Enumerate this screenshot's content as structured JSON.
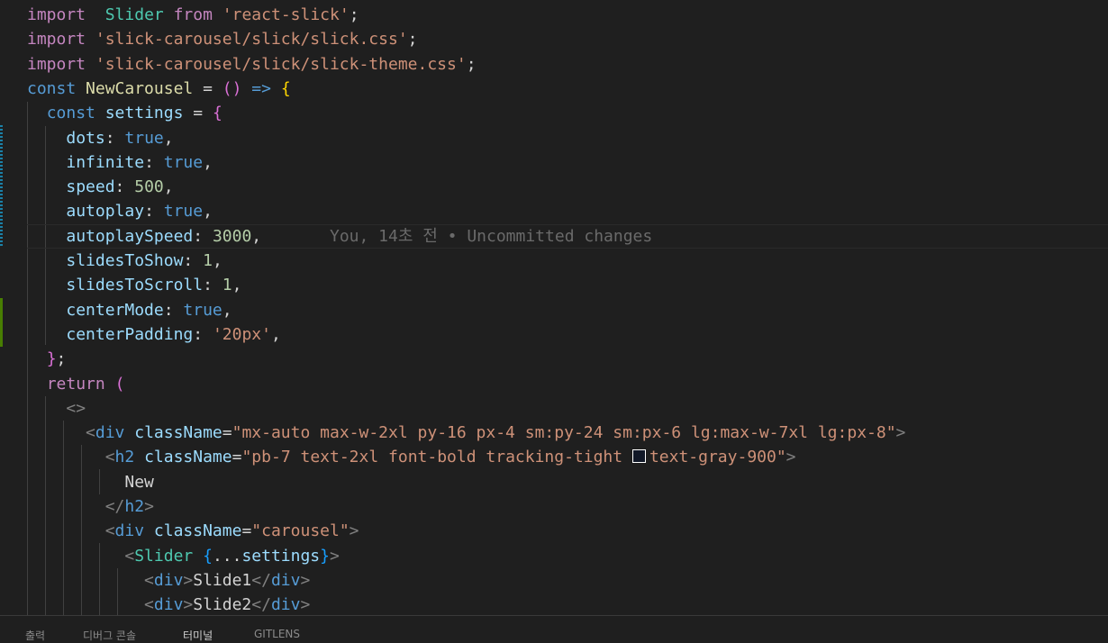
{
  "lines": [
    {
      "t": [
        [
          "kw",
          "import"
        ],
        [
          "",
          "  "
        ],
        [
          "tp",
          "Slider"
        ],
        [
          "",
          " "
        ],
        [
          "kw",
          "from"
        ],
        [
          "",
          " "
        ],
        [
          "st",
          "'react-slick'"
        ],
        [
          "",
          ";"
        ]
      ]
    },
    {
      "t": [
        [
          "kw",
          "import"
        ],
        [
          "",
          " "
        ],
        [
          "st",
          "'slick-carousel/slick/slick.css'"
        ],
        [
          "",
          ";"
        ]
      ]
    },
    {
      "t": [
        [
          "kw",
          "import"
        ],
        [
          "",
          " "
        ],
        [
          "st",
          "'slick-carousel/slick/slick-theme.css'"
        ],
        [
          "",
          ";"
        ]
      ]
    },
    {
      "t": [
        [
          "sk",
          "const"
        ],
        [
          "",
          " "
        ],
        [
          "fn",
          "NewCarousel"
        ],
        [
          "",
          " = "
        ],
        [
          "br2",
          "()"
        ],
        [
          "",
          " "
        ],
        [
          "sk",
          "=>"
        ],
        [
          "",
          " "
        ],
        [
          "br1",
          "{"
        ]
      ]
    },
    {
      "t": [
        [
          "",
          "  "
        ],
        [
          "sk",
          "const"
        ],
        [
          "",
          " "
        ],
        [
          "pr",
          "settings"
        ],
        [
          "",
          " = "
        ],
        [
          "br2",
          "{"
        ]
      ]
    },
    {
      "t": [
        [
          "",
          "    "
        ],
        [
          "pr",
          "dots"
        ],
        [
          "",
          ": "
        ],
        [
          "sk",
          "true"
        ],
        [
          "",
          ","
        ]
      ]
    },
    {
      "t": [
        [
          "",
          "    "
        ],
        [
          "pr",
          "infinite"
        ],
        [
          "",
          ": "
        ],
        [
          "sk",
          "true"
        ],
        [
          "",
          ","
        ]
      ]
    },
    {
      "t": [
        [
          "",
          "    "
        ],
        [
          "pr",
          "speed"
        ],
        [
          "",
          ": "
        ],
        [
          "nu",
          "500"
        ],
        [
          "",
          ","
        ]
      ]
    },
    {
      "t": [
        [
          "",
          "    "
        ],
        [
          "pr",
          "autoplay"
        ],
        [
          "",
          ": "
        ],
        [
          "sk",
          "true"
        ],
        [
          "",
          ","
        ]
      ]
    },
    {
      "t": [
        [
          "",
          "    "
        ],
        [
          "pr",
          "autoplaySpeed"
        ],
        [
          "",
          ": "
        ],
        [
          "nu",
          "3000"
        ],
        [
          "",
          ","
        ],
        [
          "",
          "       "
        ],
        [
          "blame",
          "You, 14초 전 • Uncommitted changes"
        ]
      ]
    },
    {
      "t": [
        [
          "",
          "    "
        ],
        [
          "pr",
          "slidesToShow"
        ],
        [
          "",
          ": "
        ],
        [
          "nu",
          "1"
        ],
        [
          "",
          ","
        ]
      ]
    },
    {
      "t": [
        [
          "",
          "    "
        ],
        [
          "pr",
          "slidesToScroll"
        ],
        [
          "",
          ": "
        ],
        [
          "nu",
          "1"
        ],
        [
          "",
          ","
        ]
      ]
    },
    {
      "t": [
        [
          "",
          "    "
        ],
        [
          "pr",
          "centerMode"
        ],
        [
          "",
          ": "
        ],
        [
          "sk",
          "true"
        ],
        [
          "",
          ","
        ]
      ]
    },
    {
      "t": [
        [
          "",
          "    "
        ],
        [
          "pr",
          "centerPadding"
        ],
        [
          "",
          ": "
        ],
        [
          "st",
          "'20px'"
        ],
        [
          "",
          ","
        ]
      ]
    },
    {
      "t": [
        [
          "",
          "  "
        ],
        [
          "br2",
          "}"
        ],
        [
          "",
          ";"
        ]
      ]
    },
    {
      "t": [
        [
          "",
          "  "
        ],
        [
          "kw",
          "return"
        ],
        [
          "",
          " "
        ],
        [
          "br2",
          "("
        ]
      ]
    },
    {
      "t": [
        [
          "",
          "    "
        ],
        [
          "pu",
          "<>"
        ]
      ]
    },
    {
      "t": [
        [
          "",
          "      "
        ],
        [
          "pu",
          "<"
        ],
        [
          "tg",
          "div"
        ],
        [
          "",
          " "
        ],
        [
          "pr",
          "className"
        ],
        [
          "",
          "="
        ],
        [
          "st",
          "\"mx-auto max-w-2xl py-16 px-4 sm:py-24 sm:px-6 lg:max-w-7xl lg:px-8\""
        ],
        [
          "pu",
          ">"
        ]
      ]
    },
    {
      "t": [
        [
          "",
          "        "
        ],
        [
          "pu",
          "<"
        ],
        [
          "tg",
          "h2"
        ],
        [
          "",
          " "
        ],
        [
          "pr",
          "className"
        ],
        [
          "",
          "="
        ],
        [
          "st",
          "\"pb-7 text-2xl font-bold tracking-tight "
        ],
        [
          "swatch",
          ""
        ],
        [
          "st",
          "text-gray-900\""
        ],
        [
          "pu",
          ">"
        ]
      ]
    },
    {
      "t": [
        [
          "",
          "          "
        ],
        [
          "",
          "New"
        ]
      ]
    },
    {
      "t": [
        [
          "",
          "        "
        ],
        [
          "pu",
          "</"
        ],
        [
          "tg",
          "h2"
        ],
        [
          "pu",
          ">"
        ]
      ]
    },
    {
      "t": [
        [
          "",
          "        "
        ],
        [
          "pu",
          "<"
        ],
        [
          "tg",
          "div"
        ],
        [
          "",
          " "
        ],
        [
          "pr",
          "className"
        ],
        [
          "",
          "="
        ],
        [
          "st",
          "\"carousel\""
        ],
        [
          "pu",
          ">"
        ]
      ]
    },
    {
      "t": [
        [
          "",
          "          "
        ],
        [
          "pu",
          "<"
        ],
        [
          "tp",
          "Slider"
        ],
        [
          "",
          " "
        ],
        [
          "br3",
          "{"
        ],
        [
          "",
          "..."
        ],
        [
          "pr",
          "settings"
        ],
        [
          "br3",
          "}"
        ],
        [
          "pu",
          ">"
        ]
      ]
    },
    {
      "t": [
        [
          "",
          "            "
        ],
        [
          "pu",
          "<"
        ],
        [
          "tg",
          "div"
        ],
        [
          "pu",
          ">"
        ],
        [
          "",
          "Slide1"
        ],
        [
          "pu",
          "</"
        ],
        [
          "tg",
          "div"
        ],
        [
          "pu",
          ">"
        ]
      ]
    },
    {
      "t": [
        [
          "",
          "            "
        ],
        [
          "pu",
          "<"
        ],
        [
          "tg",
          "div"
        ],
        [
          "pu",
          ">"
        ],
        [
          "",
          "Slide2"
        ],
        [
          "pu",
          "</"
        ],
        [
          "tg",
          "div"
        ],
        [
          "pu",
          ">"
        ]
      ]
    }
  ],
  "panel_tabs": [
    "출력",
    "디버그 콘솔",
    "터미널",
    "GITLENS"
  ],
  "colors": {
    "background": "#1f1f1f",
    "gutter_modified": "#1b81a8",
    "gutter_added": "#487e02",
    "swatch": "#111827"
  }
}
